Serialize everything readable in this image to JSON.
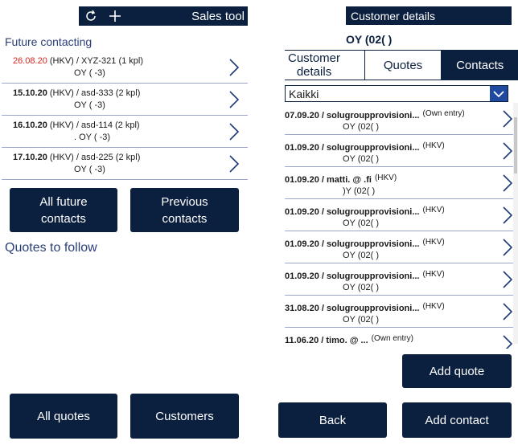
{
  "left": {
    "toolbar": {
      "refresh_icon": "refresh-icon",
      "add_icon": "plus-icon",
      "title": "Sales tool"
    },
    "future_title": "Future contacting",
    "future_items": [
      {
        "date": "26.08.20",
        "date_color": "#d8261e",
        "info": "(HKV) / XYZ-321 (1 kpl)",
        "customer": "OY (                  -3)"
      },
      {
        "date": "15.10.20",
        "info": "(HKV) / asd-333 (2 kpl)",
        "customer": "OY (                  -3)"
      },
      {
        "date": "16.10.20",
        "info": "(HKV) / asd-114 (2 kpl)",
        "customer": ". OY (                  -3)"
      },
      {
        "date": "17.10.20",
        "info": "(HKV) / asd-225 (2 kpl)",
        "customer": "OY (                  -3)"
      }
    ],
    "btn_all_future": "All future\ncontacts",
    "btn_previous": "Previous\ncontacts",
    "quotes_title": "Quotes to follow",
    "btn_all_quotes": "All quotes",
    "btn_customers": "Customers"
  },
  "right": {
    "header": "Customer details",
    "customer_name": "OY (02(                 )",
    "tabs": [
      {
        "label": "Customer\ndetails",
        "active": false
      },
      {
        "label": "Quotes",
        "active": false
      },
      {
        "label": "Contacts",
        "active": true
      }
    ],
    "filter_value": "Kaikki",
    "contacts": [
      {
        "title": "07.09.20 / solugroupprovisioni...",
        "tag": "(Own entry)",
        "sub": "OY (02(                 )"
      },
      {
        "title": "01.09.20 / solugroupprovisioni...",
        "tag": "(HKV)",
        "sub": "OY (02(                 )"
      },
      {
        "title": "01.09.20 / matti.              @            .fi",
        "tag": "(HKV)",
        "sub": ")Y (02(                 )"
      },
      {
        "title": "01.09.20 / solugroupprovisioni...",
        "tag": "(HKV)",
        "sub": "OY (02(                 )"
      },
      {
        "title": "01.09.20 / solugroupprovisioni...",
        "tag": "(HKV)",
        "sub": "OY (02(                 )"
      },
      {
        "title": "01.09.20 / solugroupprovisioni...",
        "tag": "(HKV)",
        "sub": "OY (02(                 )"
      },
      {
        "title": "31.08.20 / solugroupprovisioni...",
        "tag": "(HKV)",
        "sub": "OY (02(                 )"
      },
      {
        "title": "11.06.20 / timo.              @            ...",
        "tag": "(Own entry)",
        "sub": ""
      }
    ],
    "btn_add_quote": "Add quote",
    "btn_back": "Back",
    "btn_add_contact": "Add contact"
  },
  "colors": {
    "navy": "#0b1f3f",
    "accent_blue": "#1f4aa0",
    "red_date": "#d8261e"
  }
}
